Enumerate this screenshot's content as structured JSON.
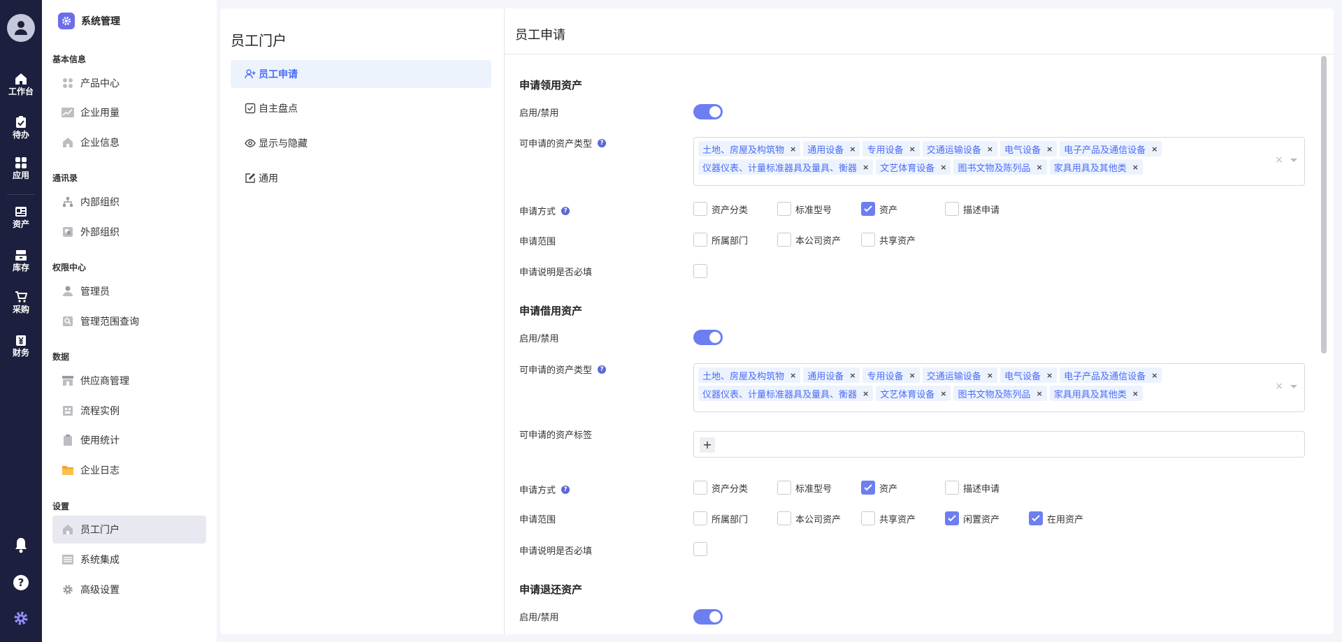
{
  "rail": {
    "items": [
      {
        "label": "工作台",
        "icon": "home-icon"
      },
      {
        "label": "待办",
        "icon": "clipboard-check-icon"
      },
      {
        "label": "应用",
        "icon": "apps-icon"
      },
      {
        "label": "资产",
        "icon": "asset-card-icon"
      },
      {
        "label": "库存",
        "icon": "inventory-icon"
      },
      {
        "label": "采购",
        "icon": "cart-icon"
      },
      {
        "label": "财务",
        "icon": "finance-icon"
      }
    ],
    "bottom": [
      "bell-icon",
      "help-icon",
      "gear-icon"
    ]
  },
  "sidebar": {
    "title": "系统管理",
    "groups": [
      {
        "title": "基本信息",
        "items": [
          "产品中心",
          "企业用量",
          "企业信息"
        ]
      },
      {
        "title": "通讯录",
        "items": [
          "内部组织",
          "外部组织"
        ]
      },
      {
        "title": "权限中心",
        "items": [
          "管理员",
          "管理范围查询"
        ]
      },
      {
        "title": "数据",
        "items": [
          "供应商管理",
          "流程实例",
          "使用统计",
          "企业日志"
        ]
      },
      {
        "title": "设置",
        "items": [
          "员工门户",
          "系统集成",
          "高级设置"
        ]
      }
    ],
    "active": "员工门户"
  },
  "portal": {
    "title": "员工门户",
    "menu": [
      "员工申请",
      "自主盘点",
      "显示与隐藏",
      "通用"
    ],
    "active": "员工申请"
  },
  "content": {
    "title": "员工申请",
    "asset_types": [
      "土地、房屋及构筑物",
      "通用设备",
      "专用设备",
      "交通运输设备",
      "电气设备",
      "电子产品及通信设备",
      "仪器仪表、计量标准器具及量具、衡器",
      "文艺体育设备",
      "图书文物及陈列品",
      "家具用具及其他类"
    ],
    "sections": {
      "s1": {
        "title": "申请领用资产",
        "enable_label": "启用/禁用",
        "types_label": "可申请的资产类型",
        "method_label": "申请方式",
        "methods": [
          {
            "label": "资产分类",
            "checked": false
          },
          {
            "label": "标准型号",
            "checked": false
          },
          {
            "label": "资产",
            "checked": true
          },
          {
            "label": "描述申请",
            "checked": false
          }
        ],
        "scope_label": "申请范围",
        "scopes": [
          {
            "label": "所属部门",
            "checked": false
          },
          {
            "label": "本公司资产",
            "checked": false
          },
          {
            "label": "共享资产",
            "checked": false
          }
        ],
        "required_label": "申请说明是否必填"
      },
      "s2": {
        "title": "申请借用资产",
        "enable_label": "启用/禁用",
        "types_label": "可申请的资产类型",
        "tags_label": "可申请的资产标签",
        "method_label": "申请方式",
        "methods": [
          {
            "label": "资产分类",
            "checked": false
          },
          {
            "label": "标准型号",
            "checked": false
          },
          {
            "label": "资产",
            "checked": true
          },
          {
            "label": "描述申请",
            "checked": false
          }
        ],
        "scope_label": "申请范围",
        "scopes": [
          {
            "label": "所属部门",
            "checked": false
          },
          {
            "label": "本公司资产",
            "checked": false
          },
          {
            "label": "共享资产",
            "checked": false
          },
          {
            "label": "闲置资产",
            "checked": true
          },
          {
            "label": "在用资产",
            "checked": true
          }
        ],
        "required_label": "申请说明是否必填"
      },
      "s3": {
        "title": "申请退还资产",
        "enable_label": "启用/禁用"
      }
    }
  },
  "colors": {
    "accent": "#6d7ef0",
    "rail": "#1c1f3d",
    "tag_bg": "#edf3fd",
    "tag_text": "#4a6cf7"
  }
}
